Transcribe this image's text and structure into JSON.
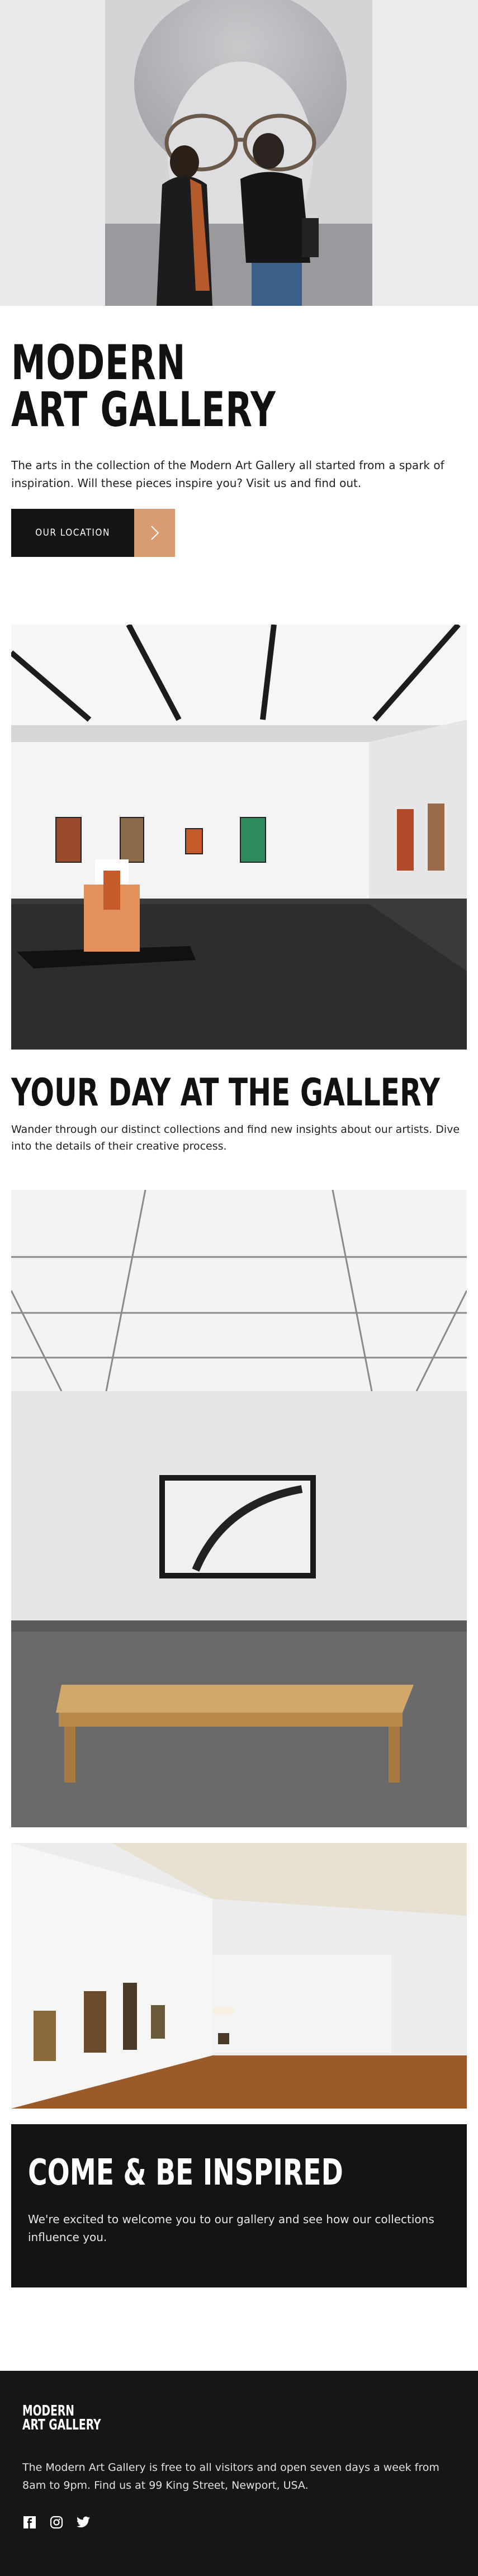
{
  "brand": {
    "title_line1": "MODERN",
    "title_line2": "ART GALLERY"
  },
  "intro": {
    "text": "The arts in the collection of the Modern Art Gallery all started from a spark of inspiration. Will these pieces inspire you? Visit us and find out.",
    "cta_label": "OUR LOCATION",
    "cta_icon": "chevron-right-icon"
  },
  "day_section": {
    "title": "YOUR DAY AT THE GALLERY",
    "text": "Wander through our distinct collections and find new insights about our artists. Dive into the details of their creative process."
  },
  "inspire_section": {
    "title": "COME & BE INSPIRED",
    "text": "We're excited to welcome you to our gallery and see how our collections influence you."
  },
  "footer": {
    "logo_line1": "MODERN",
    "logo_line2": "ART GALLERY",
    "text": "The Modern Art Gallery is free to all visitors and open seven days a week from 8am to 9pm. Find us at 99 King Street, Newport, USA.",
    "socials": [
      "facebook-icon",
      "instagram-icon",
      "twitter-icon"
    ]
  },
  "colors": {
    "accent": "#d99c72",
    "dark": "#151515",
    "background": "#ffffff"
  }
}
